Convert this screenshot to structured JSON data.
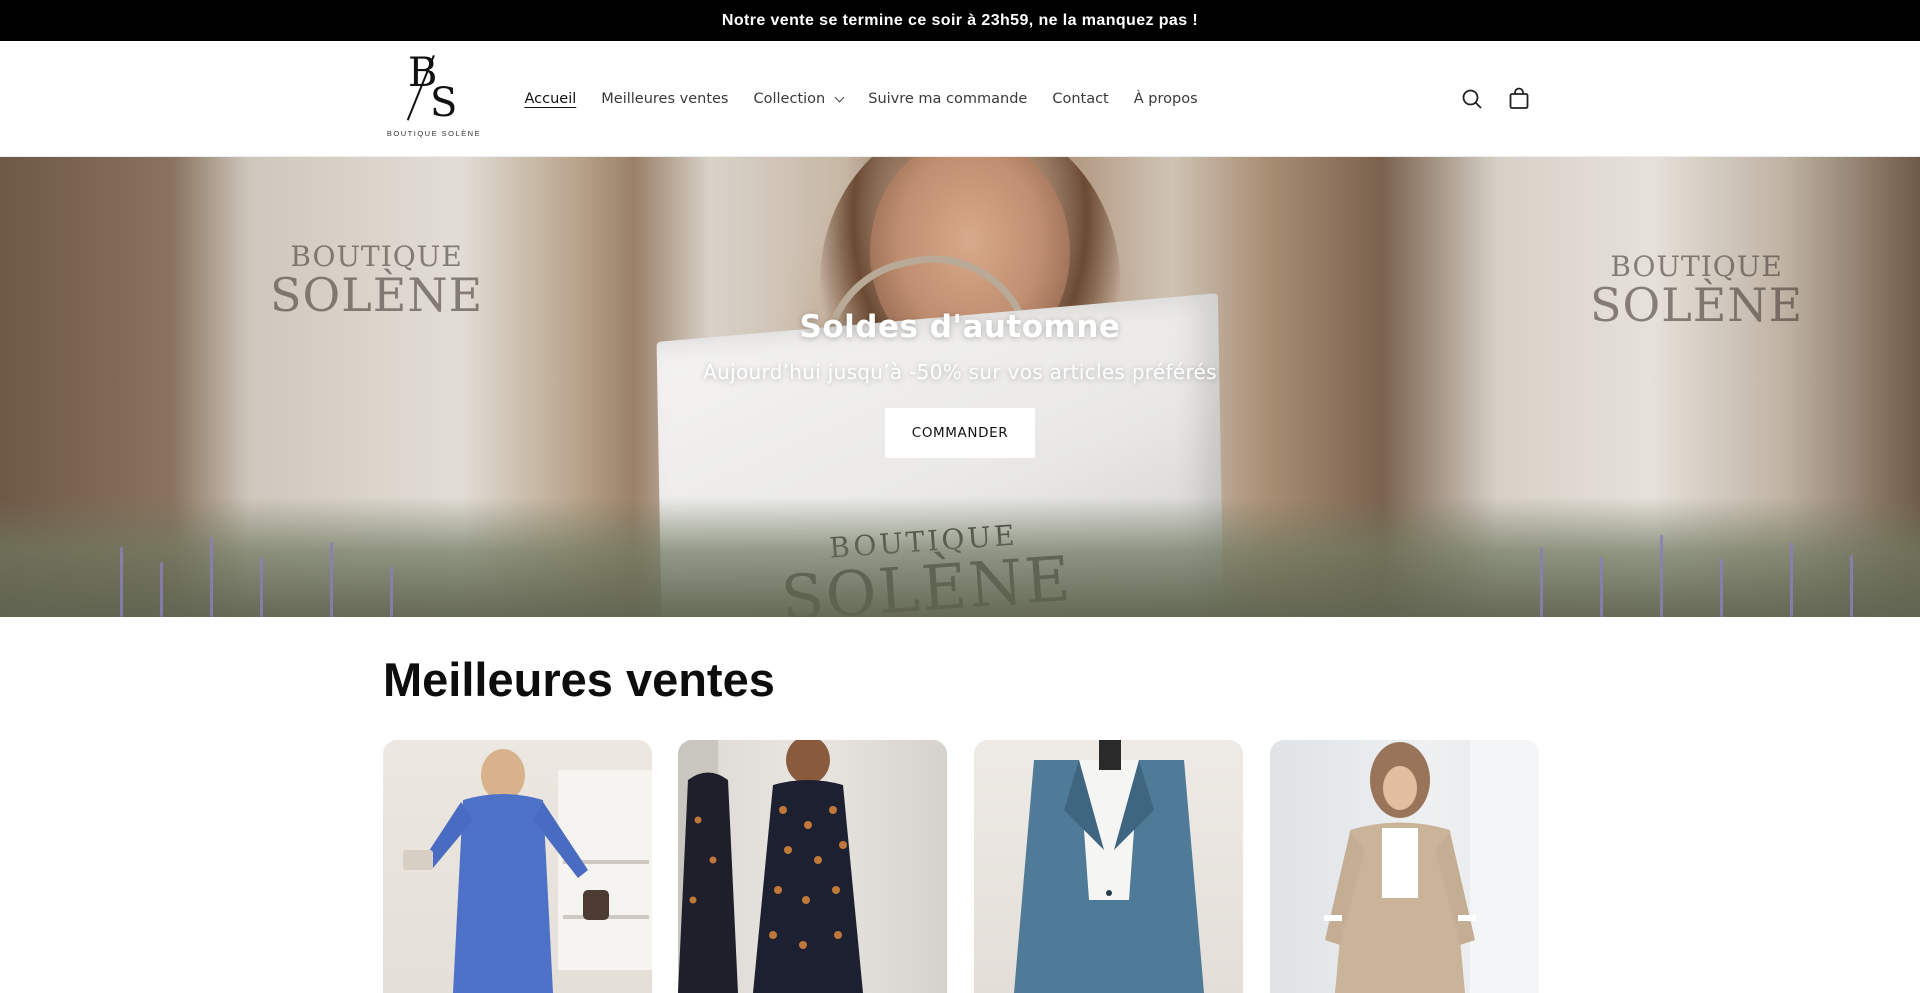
{
  "announcement": {
    "text": "Notre vente se termine ce soir à 23h59, ne la manquez pas !"
  },
  "header": {
    "logo": {
      "monogram_b": "B",
      "monogram_s": "S",
      "wordmark": "BOUTIQUE SOLÈNE"
    },
    "nav": [
      {
        "label": "Accueil",
        "active": true
      },
      {
        "label": "Meilleures ventes"
      },
      {
        "label": "Collection",
        "has_dropdown": true
      },
      {
        "label": "Suivre ma commande"
      },
      {
        "label": "Contact"
      },
      {
        "label": "À propos"
      }
    ],
    "icons": [
      "search-icon",
      "cart-icon"
    ]
  },
  "hero": {
    "title": "Soldes d'automne",
    "subtitle": "Aujourd’hui jusqu’à -50% sur vos articles préférés",
    "cta": "COMMANDER",
    "signage": {
      "line1": "BOUTIQUE",
      "line2": "SOLÈNE"
    }
  },
  "best_sellers": {
    "title": "Meilleures ventes",
    "products": [
      {
        "image": "blue knit dress with cardigan"
      },
      {
        "image": "navy polka dot wrap dress"
      },
      {
        "image": "blue blazer suit"
      },
      {
        "image": "beige satin jacket and trousers set"
      }
    ]
  },
  "colors": {
    "announcement_bg": "#000000",
    "text": "#121212",
    "button_bg": "#ffffff"
  }
}
